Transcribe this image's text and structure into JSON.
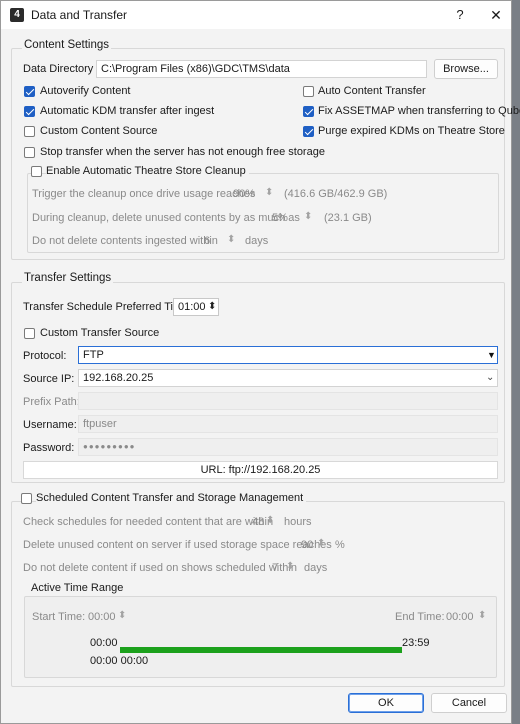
{
  "window": {
    "badge": "4",
    "title": "Data and Transfer",
    "help": "?",
    "close": "✕"
  },
  "content_settings": {
    "title": "Content Settings",
    "data_directory_label": "Data Directory :",
    "data_directory_value": "C:\\Program Files (x86)\\GDC\\TMS\\data",
    "browse": "Browse...",
    "checks": {
      "autoverify": {
        "label": "Autoverify Content",
        "checked": true
      },
      "auto_content_transfer": {
        "label": "Auto Content Transfer",
        "checked": false
      },
      "auto_kdm": {
        "label": "Automatic KDM transfer after ingest",
        "checked": true
      },
      "fix_assetmap": {
        "label": "Fix ASSETMAP when transferring to Qube",
        "checked": true
      },
      "custom_source": {
        "label": "Custom Content Source",
        "checked": false
      },
      "purge_kdms": {
        "label": "Purge expired KDMs on Theatre Store",
        "checked": true
      },
      "stop_transfer": {
        "label": "Stop transfer when the server has not enough free storage",
        "checked": false
      }
    },
    "cleanup": {
      "enable_label": "Enable Automatic Theatre Store Cleanup",
      "enabled": false,
      "trigger_label": "Trigger the cleanup once drive usage reaches",
      "trigger_value": "90%",
      "trigger_info": "(416.6 GB/462.9 GB)",
      "delete_label": "During cleanup, delete unused contents by as much as",
      "delete_value": "5%",
      "delete_info": "(23.1 GB)",
      "nodelete_label": "Do not delete contents ingested within",
      "nodelete_value": "6",
      "nodelete_unit": "days"
    }
  },
  "transfer_settings": {
    "title": "Transfer Settings",
    "schedule_label": "Transfer Schedule Preferred Time:",
    "schedule_value": "01:00",
    "custom_source_label": "Custom Transfer Source",
    "custom_source_checked": false,
    "protocol_label": "Protocol:",
    "protocol_value": "FTP",
    "source_ip_label": "Source IP:",
    "source_ip_value": "192.168.20.25",
    "prefix_label": "Prefix Path:",
    "prefix_value": "",
    "username_label": "Username:",
    "username_value": "ftpuser",
    "password_label": "Password:",
    "password_value": "●●●●●●●●●",
    "url": "URL: ftp://192.168.20.25"
  },
  "scheduled": {
    "title": "Scheduled Content Transfer and Storage Management",
    "checked": false,
    "check_label": "Check schedules for needed content that are within",
    "check_value": "48",
    "check_unit": "hours",
    "delete_label": "Delete unused content on server if used storage space reaches",
    "delete_value": "90",
    "delete_unit": "%",
    "nodelete_label": "Do not delete content if used on shows scheduled within",
    "nodelete_value": "7",
    "nodelete_unit": "days",
    "active_range": {
      "title": "Active Time Range",
      "start_label": "Start Time:",
      "start_value": "00:00",
      "end_label": "End Time:",
      "end_value": "00:00",
      "bar_left": "00:00",
      "bar_right": "23:59",
      "bar_bottom": "00:00 00:00",
      "fill_fraction": 1.0
    }
  },
  "footer": {
    "ok": "OK",
    "cancel": "Cancel"
  },
  "colors": {
    "accent": "#1f5fc4",
    "progress": "#1ca11c"
  }
}
